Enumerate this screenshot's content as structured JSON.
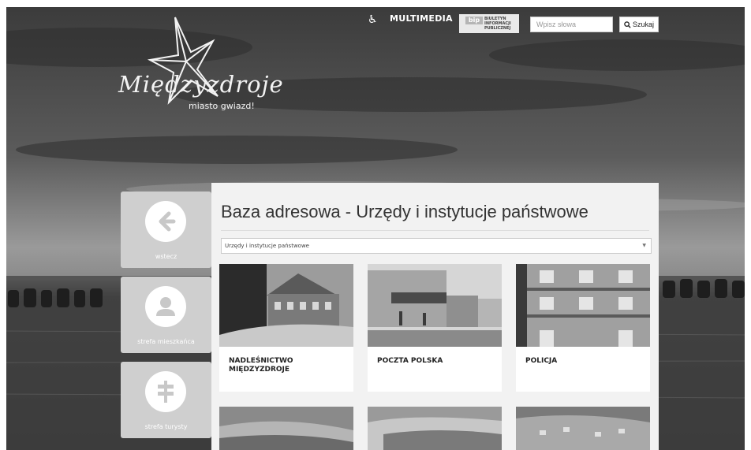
{
  "header": {
    "logo_script": "Międzyzdroje",
    "logo_tagline": "miasto gwiazd!",
    "accessibility_icon": "wheelchair-icon",
    "multimedia_label": "MULTIMEDIA",
    "bip": {
      "logo": "bip",
      "line1": "BIULETYN",
      "line2": "INFORMACJI",
      "line3": "PUBLICZNEJ"
    },
    "search": {
      "placeholder": "Wpisz słowa",
      "button_label": "Szukaj",
      "icon": "search-icon"
    }
  },
  "sidebar": [
    {
      "label": "wstecz",
      "icon": "arrow-left-icon"
    },
    {
      "label": "strefa mieszkańca",
      "icon": "user-icon"
    },
    {
      "label": "strefa turysty",
      "icon": "signpost-icon"
    }
  ],
  "main": {
    "title": "Baza adresowa - Urzędy i instytucje państwowe",
    "category_select": {
      "selected": "Urzędy i instytucje państwowe"
    },
    "cards": [
      {
        "title": "NADLEŚNICTWO MIĘDZYZDROJE"
      },
      {
        "title": "POCZTA POLSKA"
      },
      {
        "title": "POLICJA"
      }
    ]
  },
  "colors": {
    "page_bg": "#2a2a2a",
    "panel_bg": "#f2f2f2",
    "tile_bg": "#cfcfcf"
  }
}
